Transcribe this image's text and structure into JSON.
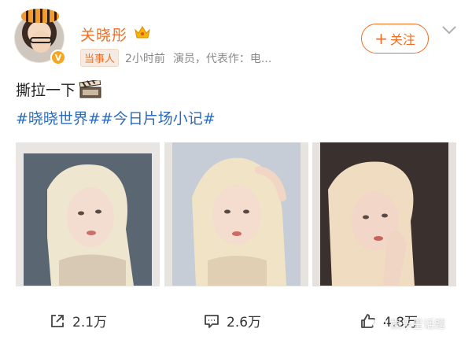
{
  "user": {
    "name": "关晓彤",
    "tag": "当事人",
    "time": "2小时前",
    "description": "演员，代表作：电..."
  },
  "header": {
    "follow_label": "关注",
    "follow_plus": "+"
  },
  "post": {
    "text": "撕拉一下",
    "hashtags": [
      "#晓晓世界#",
      "#今日片场小记#"
    ]
  },
  "actions": {
    "share_count": "2.1万",
    "comment_count": "2.6万",
    "like_count": "4.8万"
  },
  "watermark": {
    "text": "娱乐星话题"
  },
  "icons": {
    "avatar_badge": "verified-v-icon",
    "crown": "crown-icon",
    "chevron": "chevron-down-icon",
    "clapper": "clapperboard-emoji",
    "share": "share-icon",
    "comment": "comment-icon",
    "like": "thumbs-up-icon"
  },
  "colors": {
    "accent": "#f26d21",
    "link": "#2e6bb8",
    "badge_gold": "#f5a623"
  }
}
